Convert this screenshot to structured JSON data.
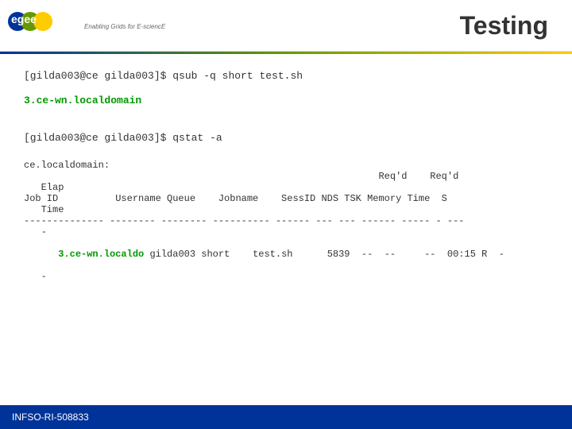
{
  "header": {
    "title": "Testing",
    "tagline": "Enabling Grids for E-sciencE",
    "logo_letters": "egee"
  },
  "content": {
    "cmd1": "[gilda003@ce gilda003]$ qsub -q short test.sh",
    "output1": "3.ce-wn.localdomain",
    "cmd2": "[gilda003@ce gilda003]$ qstat -a",
    "section_label": "ce.localdomain:",
    "table": {
      "header_line1": "                                                              Req'd    Req'd",
      "header_line2": "   Elap",
      "col_headers": "Job ID          Username Queue    Jobname    SessID NDS TSK Memory Time  S",
      "col_headers2": "   Time",
      "dashes": "-------------- -------- -------- ---------- ------ --- --- ------ ----- - ---",
      "dash2": "   -",
      "data_line1_prefix": "3.ce-wn.localdo gilda003 short    test.sh      5839  --  --     --  00:15 R",
      "data_line1_suffix": " -",
      "data_line2": "   -"
    }
  },
  "footer": {
    "text": "INFSO-RI-508833"
  }
}
